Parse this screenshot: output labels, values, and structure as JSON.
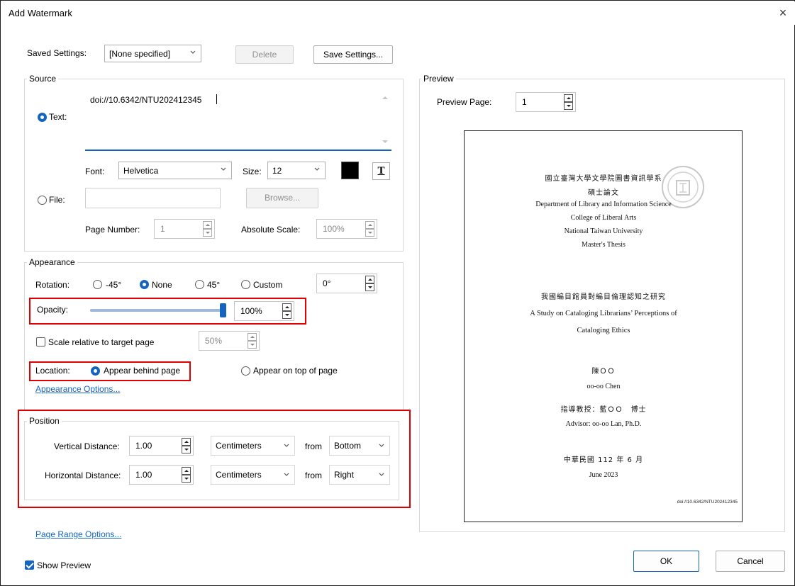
{
  "dialog": {
    "title": "Add Watermark",
    "close_glyph": "×"
  },
  "saved_settings": {
    "label": "Saved Settings:",
    "value": "[None specified]",
    "delete_label": "Delete",
    "save_label": "Save Settings..."
  },
  "source": {
    "title": "Source",
    "text_option": "Text:",
    "text_value": "doi://10.6342/NTU202412345",
    "font_label": "Font:",
    "font_value": "Helvetica",
    "size_label": "Size:",
    "size_value": "12",
    "color_swatch": "#000000",
    "text_format_glyph": "T",
    "file_option": "File:",
    "browse_label": "Browse...",
    "page_number_label": "Page Number:",
    "page_number_value": "1",
    "absolute_scale_label": "Absolute Scale:",
    "absolute_scale_value": "100%"
  },
  "appearance": {
    "title": "Appearance",
    "rotation_label": "Rotation:",
    "rotation_options": [
      "-45°",
      "None",
      "45°",
      "Custom"
    ],
    "rotation_selected": "None",
    "rotation_custom_value": "0°",
    "opacity_label": "Opacity:",
    "opacity_value": "100%",
    "opacity_level": 1.0,
    "scale_label": "Scale relative to target page",
    "scale_checked": false,
    "scale_value": "50%",
    "location_label": "Location:",
    "location_behind": "Appear behind page",
    "location_top": "Appear on top of page",
    "location_selected": "behind",
    "options_link": "Appearance Options..."
  },
  "position": {
    "title": "Position",
    "vertical_label": "Vertical Distance:",
    "vertical_value": "1.00",
    "vertical_unit": "Centimeters",
    "vertical_from_label": "from",
    "vertical_from": "Bottom",
    "horizontal_label": "Horizontal Distance:",
    "horizontal_value": "1.00",
    "horizontal_unit": "Centimeters",
    "horizontal_from_label": "from",
    "horizontal_from": "Right"
  },
  "page_range_link": "Page Range Options...",
  "show_preview": {
    "label": "Show Preview",
    "checked": true
  },
  "preview": {
    "title": "Preview",
    "page_label": "Preview Page:",
    "page_value": "1",
    "doc_lines": {
      "l1": "國立臺灣大學文學院圖書資訊學系",
      "l2": "碩士論文",
      "l3": "Department of Library and Information Science",
      "l4": "College of Liberal Arts",
      "l5": "National Taiwan University",
      "l6": "Master's Thesis",
      "l7": "我國編目館員對編目倫理認知之研究",
      "l8": "A Study on Cataloging Librarians’ Perceptions of",
      "l9": "Cataloging Ethics",
      "l10": "陳ＯＯ",
      "l11": "oo-oo Chen",
      "l12": "指導教授：藍ＯＯ　博士",
      "l13": "Advisor: oo-oo Lan, Ph.D.",
      "l14": "中華民國 112 年 6 月",
      "l15": "June 2023"
    },
    "watermark_text": "doi://10.6342/NTU202412345"
  },
  "buttons": {
    "ok": "OK",
    "cancel": "Cancel"
  },
  "colors": {
    "accent": "#1565c0",
    "highlight": "#e00000"
  }
}
